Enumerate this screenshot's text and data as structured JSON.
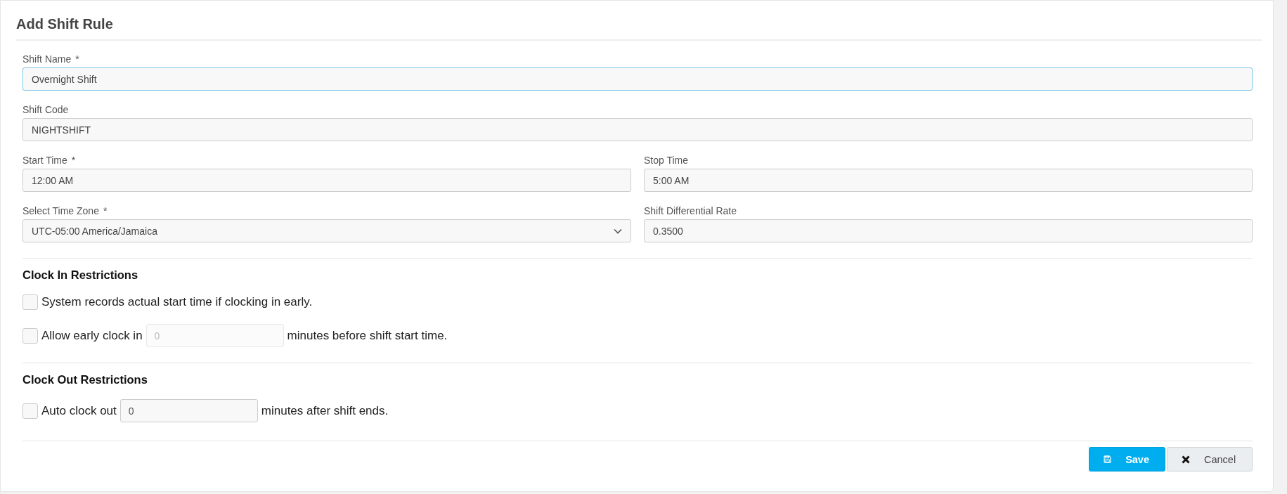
{
  "title": "Add Shift Rule",
  "field_rows": [
    [
      {
        "kind": "text",
        "label": "Shift Name",
        "required_mark": "*",
        "value": "Overnight Shift",
        "focused": true
      }
    ],
    [
      {
        "kind": "text",
        "label": "Shift Code",
        "value": "NIGHTSHIFT",
        "focused": false
      }
    ],
    [
      {
        "kind": "text",
        "label": "Start Time",
        "required_mark": "*",
        "value": "12:00 AM",
        "focused": false
      },
      {
        "kind": "text",
        "label": "Stop Time",
        "value": "5:00 AM",
        "focused": false
      }
    ],
    [
      {
        "kind": "select",
        "label": "Select Time Zone",
        "required_mark": "*",
        "value": "UTC-05:00 America/Jamaica",
        "focused": false
      },
      {
        "kind": "text",
        "label": "Shift Differential Rate",
        "value": "0.3500",
        "focused": false
      }
    ]
  ],
  "sections": [
    {
      "heading": "Clock In Restrictions",
      "rows": [
        {
          "kind": "plain",
          "checked": false,
          "text": "System records actual start time if clocking in early."
        },
        {
          "kind": "with_input",
          "checked": false,
          "text": "Allow early clock in",
          "input": {
            "value": "0",
            "disabled": true
          },
          "after": "minutes before shift start time."
        }
      ]
    },
    {
      "heading": "Clock Out Restrictions",
      "rows": [
        {
          "kind": "with_input",
          "checked": false,
          "text": "Auto clock out",
          "input": {
            "value": "0",
            "disabled": false
          },
          "after": "minutes after shift ends."
        }
      ]
    }
  ],
  "buttons": [
    {
      "kind": "primary",
      "label": "Save"
    },
    {
      "kind": "secondary",
      "label": "Cancel"
    }
  ]
}
